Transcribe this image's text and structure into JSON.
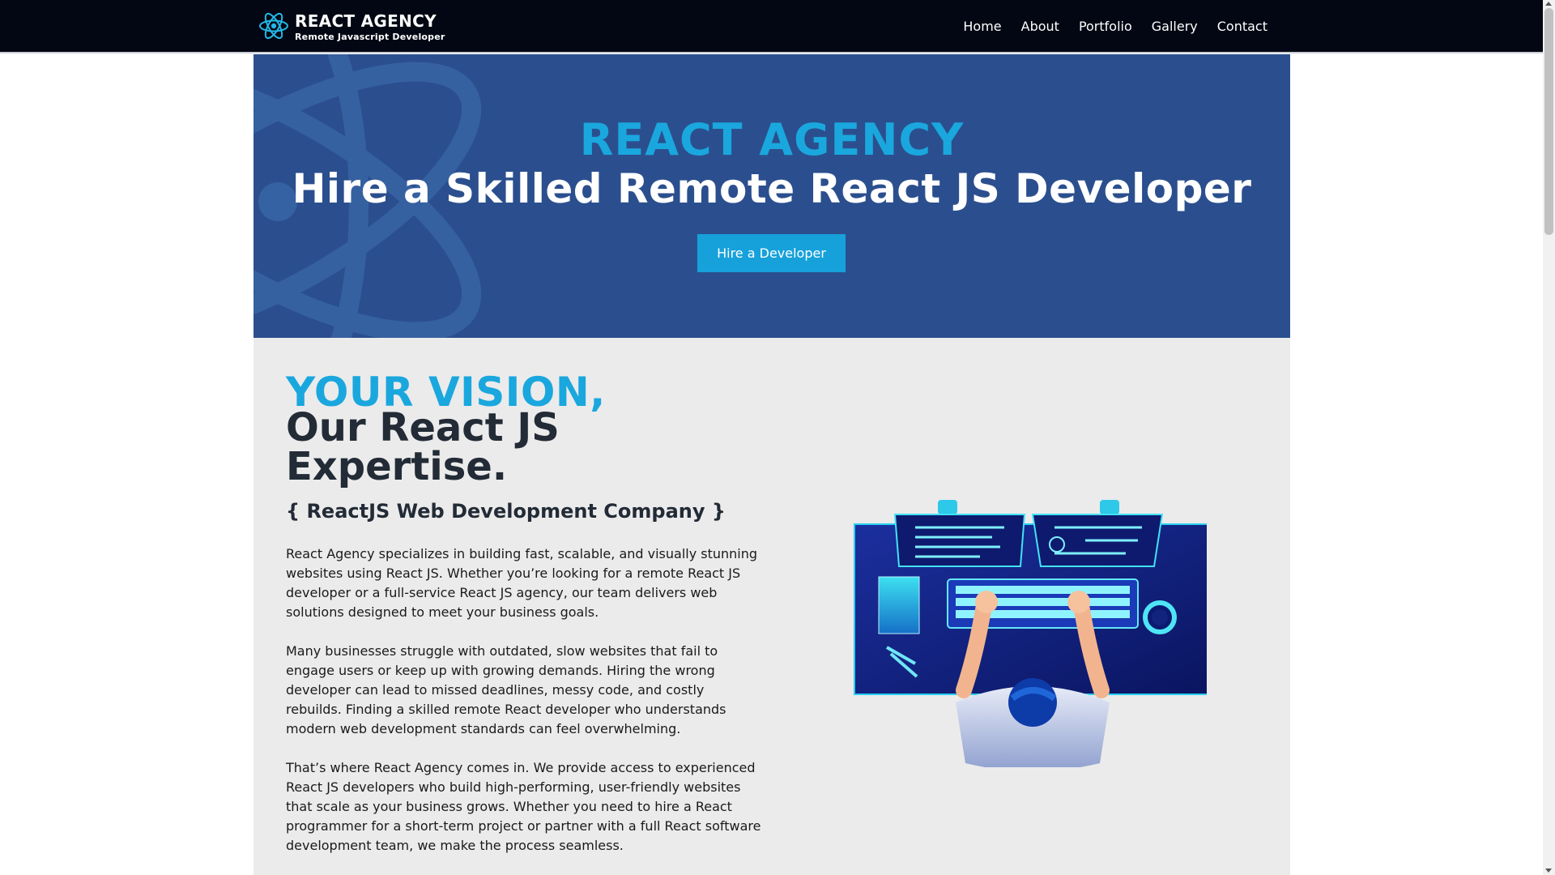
{
  "navbar": {
    "brand_title": "REACT AGENCY",
    "brand_subtitle": "Remote Javascript Developer",
    "logo_icon": "react-atom-icon",
    "links": [
      {
        "label": "Home"
      },
      {
        "label": "About"
      },
      {
        "label": "Portfolio"
      },
      {
        "label": "Gallery"
      },
      {
        "label": "Contact"
      }
    ]
  },
  "hero": {
    "kicker": "REACT AGENCY",
    "heading": "Hire a Skilled Remote React JS Developer",
    "button_label": "Hire a Developer"
  },
  "about": {
    "kicker": "YOUR VISION,",
    "heading": "Our React JS Expertise.",
    "tagline": "{ ReactJS Web Development Company }",
    "paragraphs": [
      "React Agency specializes in building fast, scalable, and visually stunning websites using React JS. Whether you’re looking for a remote React JS developer or a full-service React JS agency, our team delivers web solutions designed to meet your business goals.",
      "Many businesses struggle with outdated, slow websites that fail to engage users or keep up with growing demands. Hiring the wrong developer can lead to missed deadlines, messy code, and costly rebuilds. Finding a skilled remote React developer who understands modern web development standards can feel overwhelming.",
      "That’s where React Agency comes in. We provide access to experienced React JS developers who build high-performing, user-friendly websites that scale as your business grows. Whether you need to hire a React programmer for a short-term project or partner with a full React software development team, we make the process seamless."
    ],
    "illustration": "developer-at-desk-illustration"
  },
  "colors": {
    "navbar_bg": "#020713",
    "accent": "#1aa7de",
    "hero_bg": "#2b4f8e",
    "section_bg": "#ebebeb",
    "heading_dark": "#222b36"
  }
}
